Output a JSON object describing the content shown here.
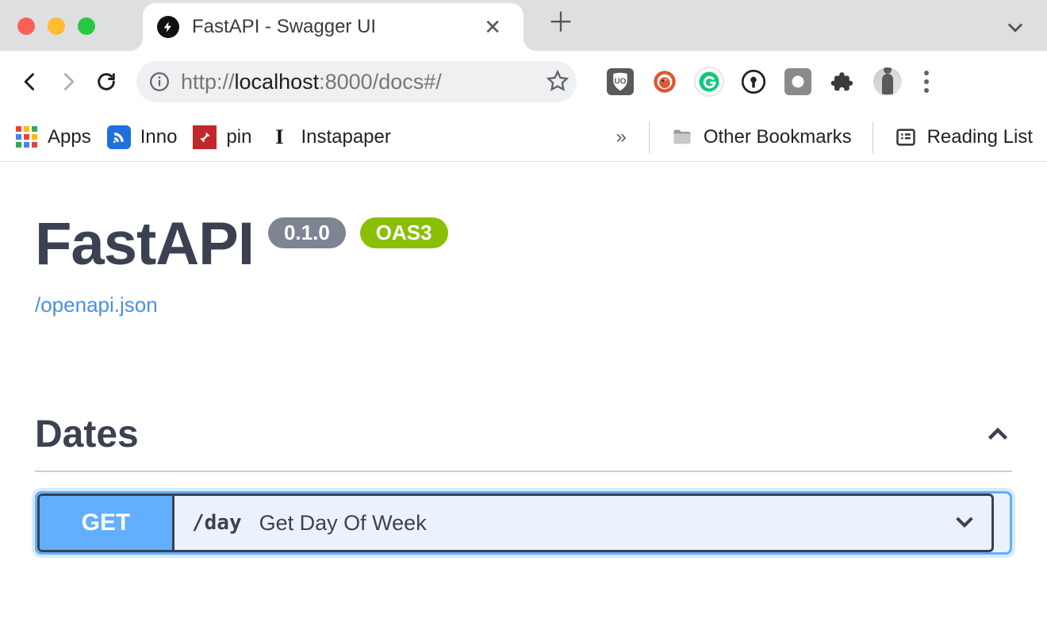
{
  "browser": {
    "tab_title": "FastAPI - Swagger UI",
    "url_scheme": "http://",
    "url_host": "localhost",
    "url_port_path": ":8000/docs#/"
  },
  "bookmarks": {
    "apps": "Apps",
    "items": [
      {
        "label": "Inno"
      },
      {
        "label": "pin"
      },
      {
        "label": "Instapaper"
      }
    ],
    "other": "Other Bookmarks",
    "reading_list": "Reading List"
  },
  "swagger": {
    "title": "FastAPI",
    "version": "0.1.0",
    "oas_badge": "OAS3",
    "spec_link": "/openapi.json",
    "tag": "Dates",
    "op": {
      "method": "GET",
      "path": "/day",
      "summary": "Get Day Of Week"
    }
  }
}
